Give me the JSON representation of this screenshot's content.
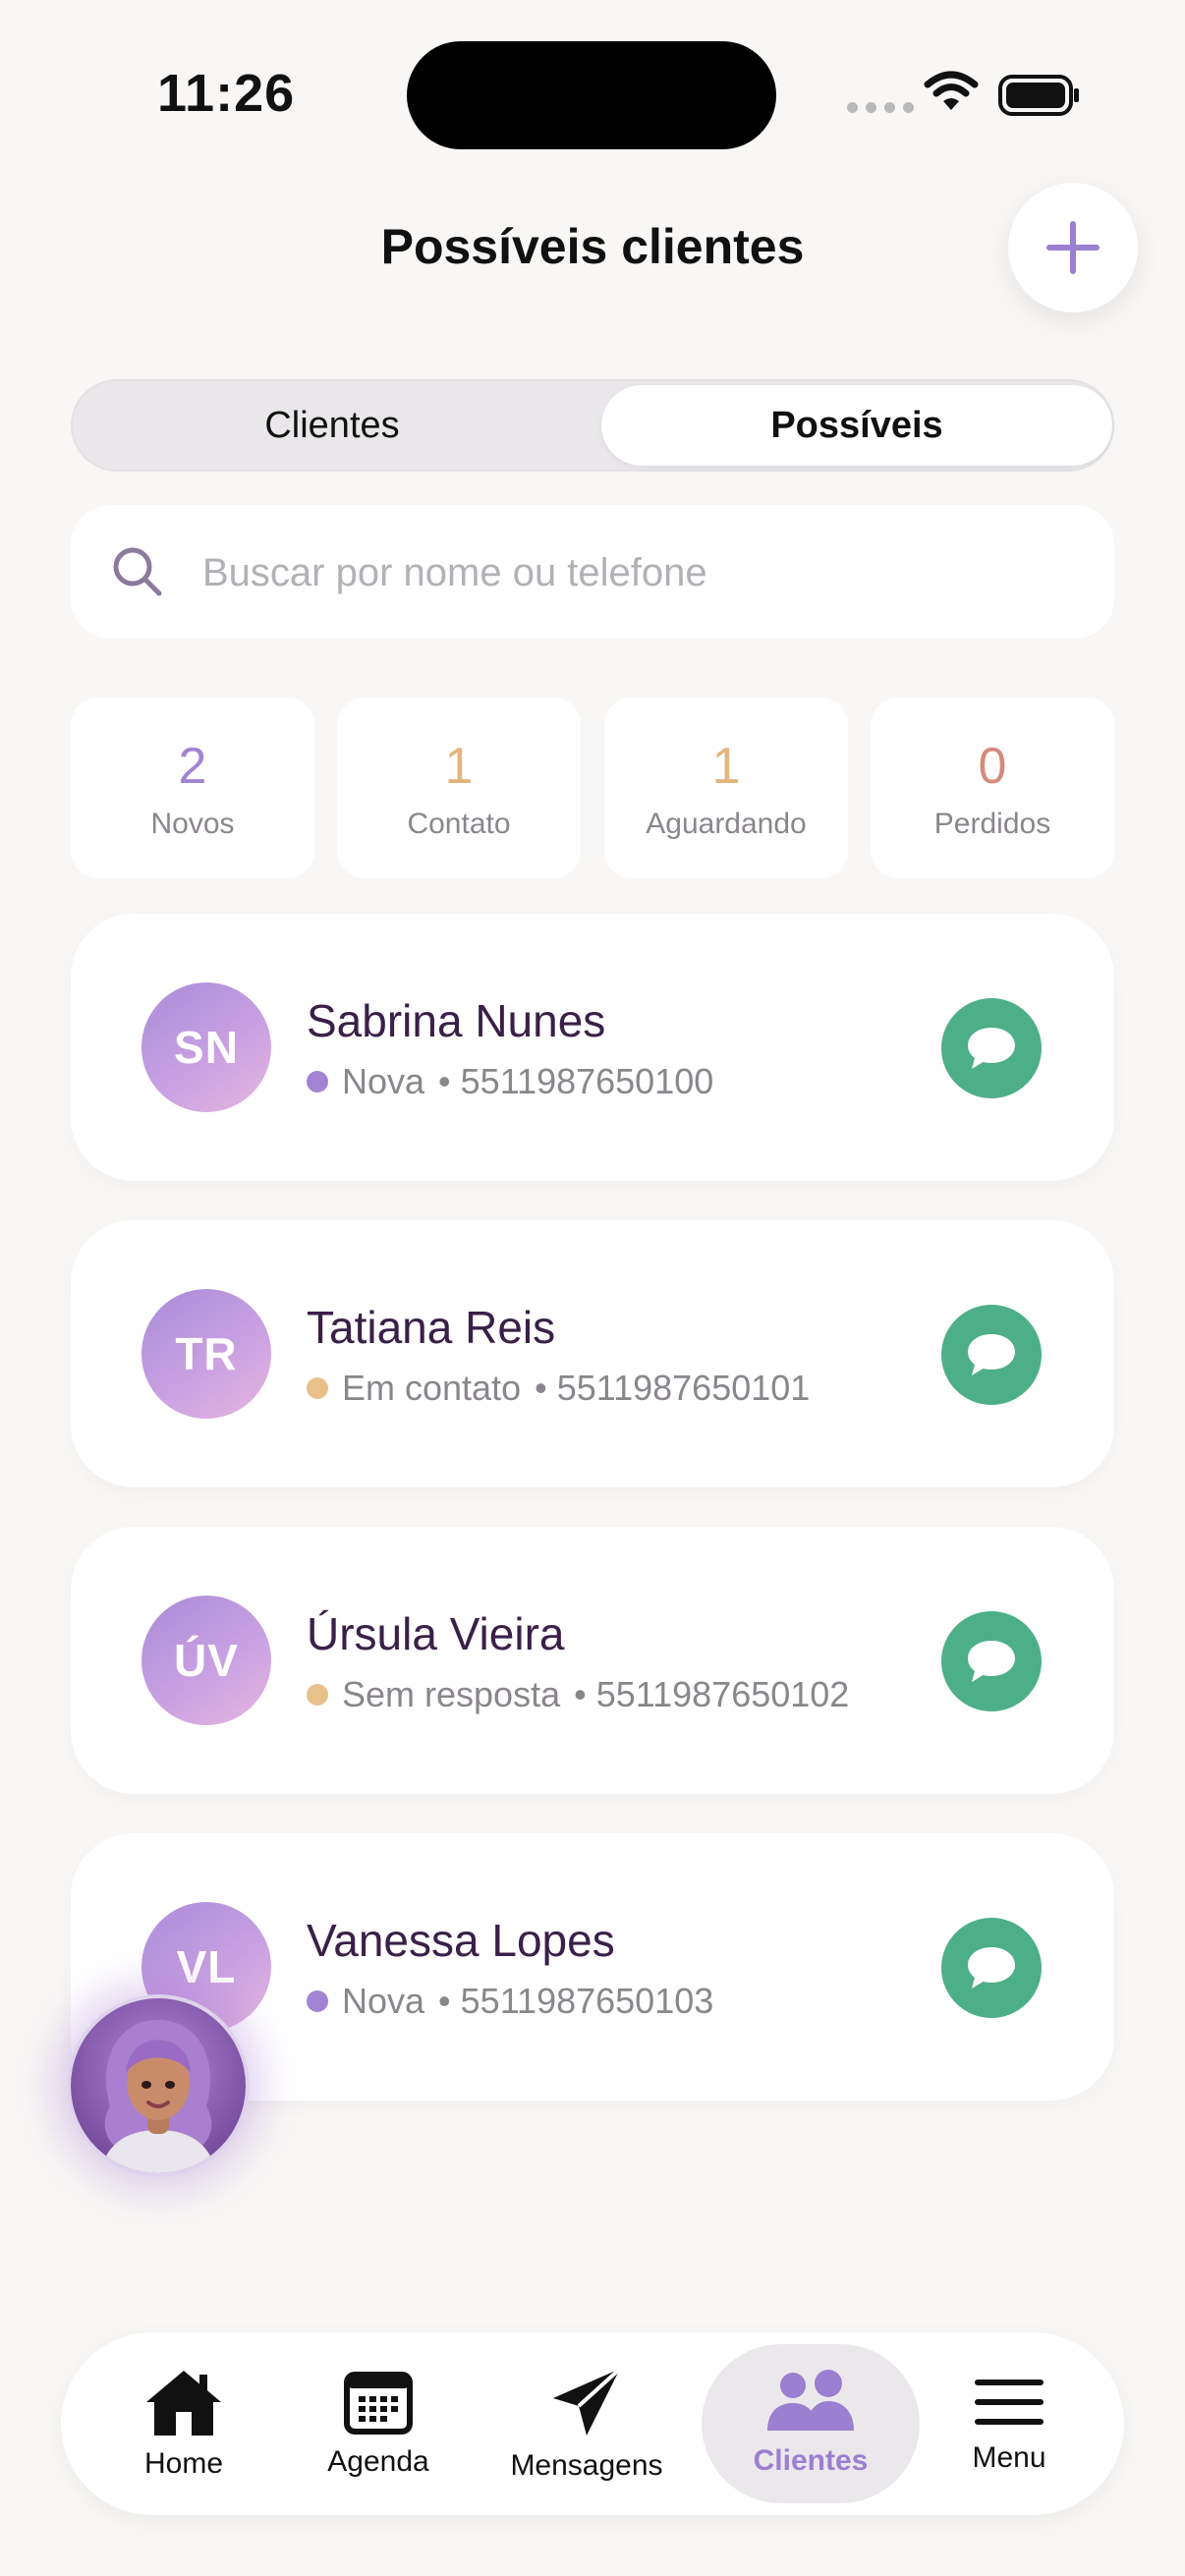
{
  "status_bar": {
    "time": "11:26"
  },
  "header": {
    "title": "Possíveis clientes"
  },
  "segments": [
    {
      "label": "Clientes",
      "active": false
    },
    {
      "label": "Possíveis",
      "active": true
    }
  ],
  "search": {
    "placeholder": "Buscar por nome ou telefone",
    "value": ""
  },
  "stats": [
    {
      "value": "2",
      "label": "Novos",
      "color": "#a283d4"
    },
    {
      "value": "1",
      "label": "Contato",
      "color": "#e3b57e"
    },
    {
      "value": "1",
      "label": "Aguardando",
      "color": "#e3b57e"
    },
    {
      "value": "0",
      "label": "Perdidos",
      "color": "#d58a7c"
    }
  ],
  "leads": [
    {
      "initials": "SN",
      "name": "Sabrina Nunes",
      "status": "Nova",
      "status_color": "#a283d4",
      "phone": "5511987650100"
    },
    {
      "initials": "TR",
      "name": "Tatiana Reis",
      "status": "Em contato",
      "status_color": "#e8c08a",
      "phone": "5511987650101"
    },
    {
      "initials": "ÚV",
      "name": "Úrsula Vieira",
      "status": "Sem resposta",
      "status_color": "#e8c08a",
      "phone": "5511987650102"
    },
    {
      "initials": "VL",
      "name": "Vanessa Lopes",
      "status": "Nova",
      "status_color": "#a283d4",
      "phone": "5511987650103"
    }
  ],
  "bottom_nav": [
    {
      "label": "Home",
      "icon": "home-icon",
      "active": false
    },
    {
      "label": "Agenda",
      "icon": "calendar-icon",
      "active": false
    },
    {
      "label": "Mensagens",
      "icon": "send-icon",
      "active": false
    },
    {
      "label": "Clientes",
      "icon": "users-icon",
      "active": true
    },
    {
      "label": "Menu",
      "icon": "menu-icon",
      "active": false
    }
  ],
  "colors": {
    "accent": "#9b7fd0",
    "whatsapp_green": "#4caf88",
    "background": "#f8f7f5"
  }
}
